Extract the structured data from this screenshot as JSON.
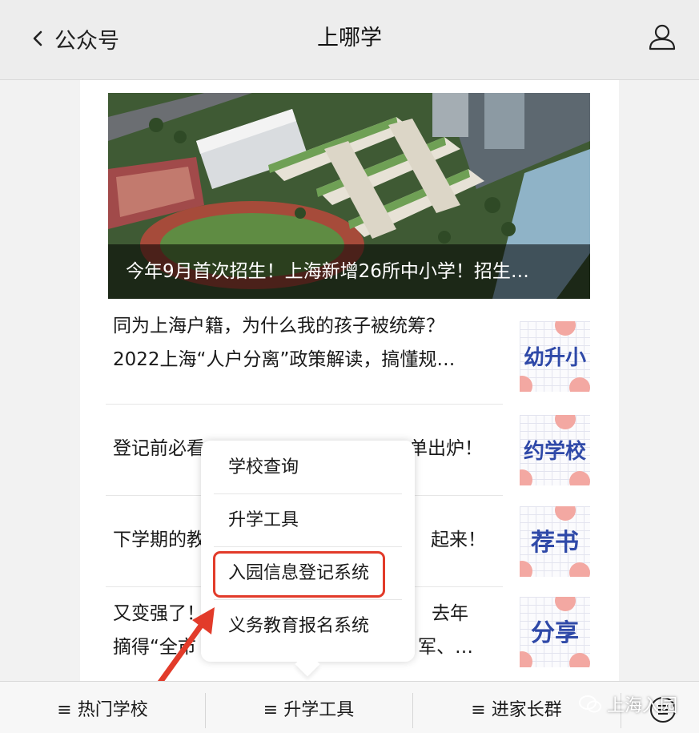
{
  "header": {
    "back_label": "公众号",
    "title": "上哪学"
  },
  "hero": {
    "caption": "今年9月首次招生！上海新增26所中小学！招生…"
  },
  "articles": [
    {
      "title": "同为上海户籍，为什么我的孩子被统筹？2022上海“人户分离”政策解读，搞懂规…",
      "thumb_text": "幼升小"
    },
    {
      "title": "登记前必看",
      "title_tail": "单出炉！",
      "thumb_text": "约学校"
    },
    {
      "title": "下学期的教",
      "title_tail": "起来！",
      "thumb_text": "荐书"
    },
    {
      "title": "又变强了！",
      "title_tail": "去年",
      "title_line2": "摘得“全市",
      "title_line2_tail": "军、…",
      "thumb_text": "分享"
    }
  ],
  "popup_menu": {
    "items": [
      "学校查询",
      "升学工具",
      "入园信息登记系统",
      "义务教育报名系统"
    ],
    "highlighted_index": 2
  },
  "bottom_menu": {
    "items": [
      "热门学校",
      "升学工具",
      "进家长群"
    ],
    "menu_glyph": "≡"
  },
  "watermark": {
    "text": "上海入园"
  },
  "colors": {
    "highlight": "#e23b2a",
    "thumb_text": "#2f49a8",
    "thumb_accent": "#f3a8a2"
  }
}
